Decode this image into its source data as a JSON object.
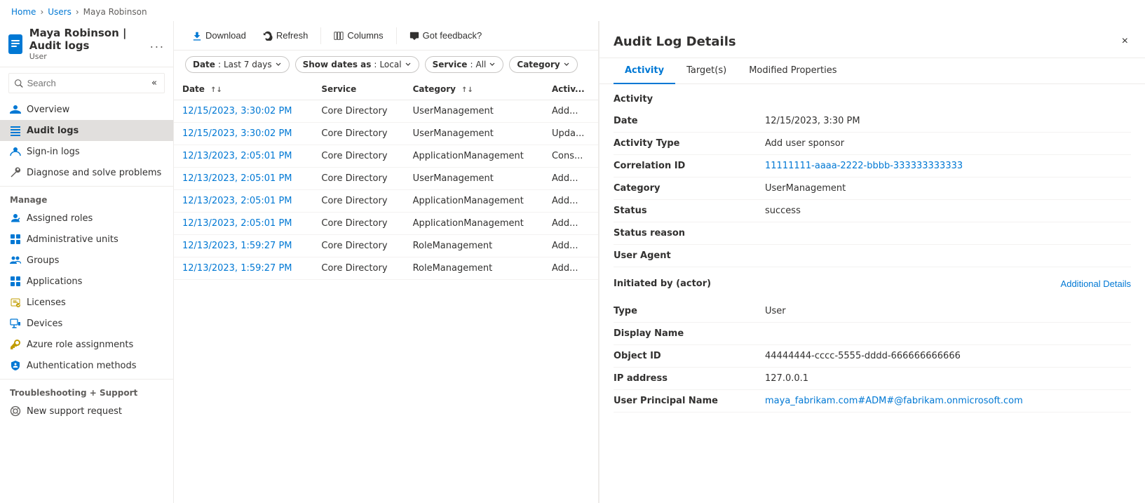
{
  "breadcrumb": {
    "items": [
      "Home",
      "Users",
      "Maya Robinson"
    ]
  },
  "sidebar": {
    "icon_box_title": "Audit logs",
    "page_title": "Maya Robinson | Audit logs",
    "page_subtitle": "User",
    "more_label": "...",
    "search_placeholder": "Search",
    "collapse_tooltip": "Collapse",
    "nav_items": [
      {
        "id": "overview",
        "label": "Overview",
        "icon": "person"
      },
      {
        "id": "audit-logs",
        "label": "Audit logs",
        "icon": "list",
        "active": true
      },
      {
        "id": "sign-in-logs",
        "label": "Sign-in logs",
        "icon": "signin"
      },
      {
        "id": "diagnose",
        "label": "Diagnose and solve problems",
        "icon": "wrench"
      }
    ],
    "manage_label": "Manage",
    "manage_items": [
      {
        "id": "assigned-roles",
        "label": "Assigned roles",
        "icon": "roles"
      },
      {
        "id": "admin-units",
        "label": "Administrative units",
        "icon": "admin"
      },
      {
        "id": "groups",
        "label": "Groups",
        "icon": "groups"
      },
      {
        "id": "applications",
        "label": "Applications",
        "icon": "apps"
      },
      {
        "id": "licenses",
        "label": "Licenses",
        "icon": "licenses"
      },
      {
        "id": "devices",
        "label": "Devices",
        "icon": "devices"
      },
      {
        "id": "azure-roles",
        "label": "Azure role assignments",
        "icon": "key"
      },
      {
        "id": "auth-methods",
        "label": "Authentication methods",
        "icon": "shield"
      }
    ],
    "troubleshooting_label": "Troubleshooting + Support",
    "support_items": [
      {
        "id": "support-request",
        "label": "New support request",
        "icon": "support"
      }
    ]
  },
  "toolbar": {
    "download_label": "Download",
    "refresh_label": "Refresh",
    "columns_label": "Columns",
    "feedback_label": "Got feedback?"
  },
  "filters": {
    "date_label": "Date",
    "date_value": "Last 7 days",
    "dates_as_label": "Show dates as",
    "dates_as_value": "Local",
    "service_label": "Service",
    "service_value": "All",
    "category_label": "Category"
  },
  "table": {
    "columns": [
      {
        "id": "date",
        "label": "Date",
        "sortable": true
      },
      {
        "id": "service",
        "label": "Service",
        "sortable": false
      },
      {
        "id": "category",
        "label": "Category",
        "sortable": true
      },
      {
        "id": "activity",
        "label": "Activ...",
        "sortable": false
      }
    ],
    "rows": [
      {
        "date": "12/15/2023, 3:30:02 PM",
        "service": "Core Directory",
        "category": "UserManagement",
        "activity": "Add..."
      },
      {
        "date": "12/15/2023, 3:30:02 PM",
        "service": "Core Directory",
        "category": "UserManagement",
        "activity": "Upda..."
      },
      {
        "date": "12/13/2023, 2:05:01 PM",
        "service": "Core Directory",
        "category": "ApplicationManagement",
        "activity": "Cons..."
      },
      {
        "date": "12/13/2023, 2:05:01 PM",
        "service": "Core Directory",
        "category": "UserManagement",
        "activity": "Add..."
      },
      {
        "date": "12/13/2023, 2:05:01 PM",
        "service": "Core Directory",
        "category": "ApplicationManagement",
        "activity": "Add..."
      },
      {
        "date": "12/13/2023, 2:05:01 PM",
        "service": "Core Directory",
        "category": "ApplicationManagement",
        "activity": "Add..."
      },
      {
        "date": "12/13/2023, 1:59:27 PM",
        "service": "Core Directory",
        "category": "RoleManagement",
        "activity": "Add..."
      },
      {
        "date": "12/13/2023, 1:59:27 PM",
        "service": "Core Directory",
        "category": "RoleManagement",
        "activity": "Add..."
      }
    ]
  },
  "panel": {
    "title": "Audit Log Details",
    "close_label": "×",
    "tabs": [
      {
        "id": "activity",
        "label": "Activity",
        "active": true
      },
      {
        "id": "targets",
        "label": "Target(s)"
      },
      {
        "id": "modified-properties",
        "label": "Modified Properties"
      }
    ],
    "activity_section": "Activity",
    "details": [
      {
        "label": "Date",
        "value": "12/15/2023, 3:30 PM",
        "type": "text"
      },
      {
        "label": "Activity Type",
        "value": "Add user sponsor",
        "type": "text"
      },
      {
        "label": "Correlation ID",
        "value": "11111111-aaaa-2222-bbbb-333333333333",
        "type": "link"
      },
      {
        "label": "Category",
        "value": "UserManagement",
        "type": "text"
      },
      {
        "label": "Status",
        "value": "success",
        "type": "text"
      },
      {
        "label": "Status reason",
        "value": "",
        "type": "text"
      },
      {
        "label": "User Agent",
        "value": "",
        "type": "text"
      }
    ],
    "initiated_label": "Initiated by (actor)",
    "additional_details_label": "Additional Details",
    "actor_details": [
      {
        "label": "Type",
        "value": "User",
        "type": "text"
      },
      {
        "label": "Display Name",
        "value": "",
        "type": "text"
      },
      {
        "label": "Object ID",
        "value": "44444444-cccc-5555-dddd-666666666666",
        "type": "text"
      },
      {
        "label": "IP address",
        "value": "127.0.0.1",
        "type": "text"
      },
      {
        "label": "User Principal Name",
        "value": "maya_fabrikam.com#ADM#@fabrikam.onmicrosoft.com",
        "type": "link"
      }
    ]
  }
}
